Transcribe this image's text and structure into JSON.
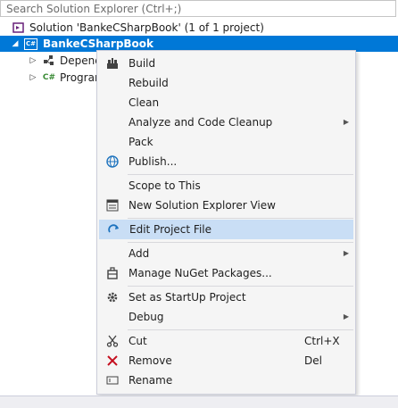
{
  "search": {
    "placeholder": "Search Solution Explorer (Ctrl+;)"
  },
  "tree": {
    "solution_label": "Solution 'BankeCSharpBook' (1 of 1 project)",
    "project_label": "BankeCSharpBook",
    "project_badge": "C#",
    "dependencies_label": "Depend",
    "program_label": "Program",
    "program_badge": "C#"
  },
  "menu": {
    "items": [
      {
        "label": "Build",
        "icon": "build-icon"
      },
      {
        "label": "Rebuild"
      },
      {
        "label": "Clean"
      },
      {
        "label": "Analyze and Code Cleanup",
        "submenu": true
      },
      {
        "label": "Pack"
      },
      {
        "label": "Publish...",
        "icon": "globe-icon"
      },
      {
        "label": "Scope to This"
      },
      {
        "label": "New Solution Explorer View",
        "icon": "window-icon"
      },
      {
        "label": "Edit Project File",
        "icon": "undo-arrow-icon",
        "highlighted": true
      },
      {
        "label": "Add",
        "submenu": true
      },
      {
        "label": "Manage NuGet Packages...",
        "icon": "nuget-icon"
      },
      {
        "label": "Set as StartUp Project",
        "icon": "gear-icon"
      },
      {
        "label": "Debug",
        "submenu": true
      },
      {
        "label": "Cut",
        "icon": "scissors-icon",
        "shortcut": "Ctrl+X"
      },
      {
        "label": "Remove",
        "icon": "close-icon",
        "shortcut": "Del"
      },
      {
        "label": "Rename",
        "icon": "rename-icon"
      }
    ]
  },
  "colors": {
    "selection": "#0078d7",
    "highlight": "#c9def5",
    "menu_bg": "#f5f5f5",
    "remove_red": "#c50f1f"
  }
}
